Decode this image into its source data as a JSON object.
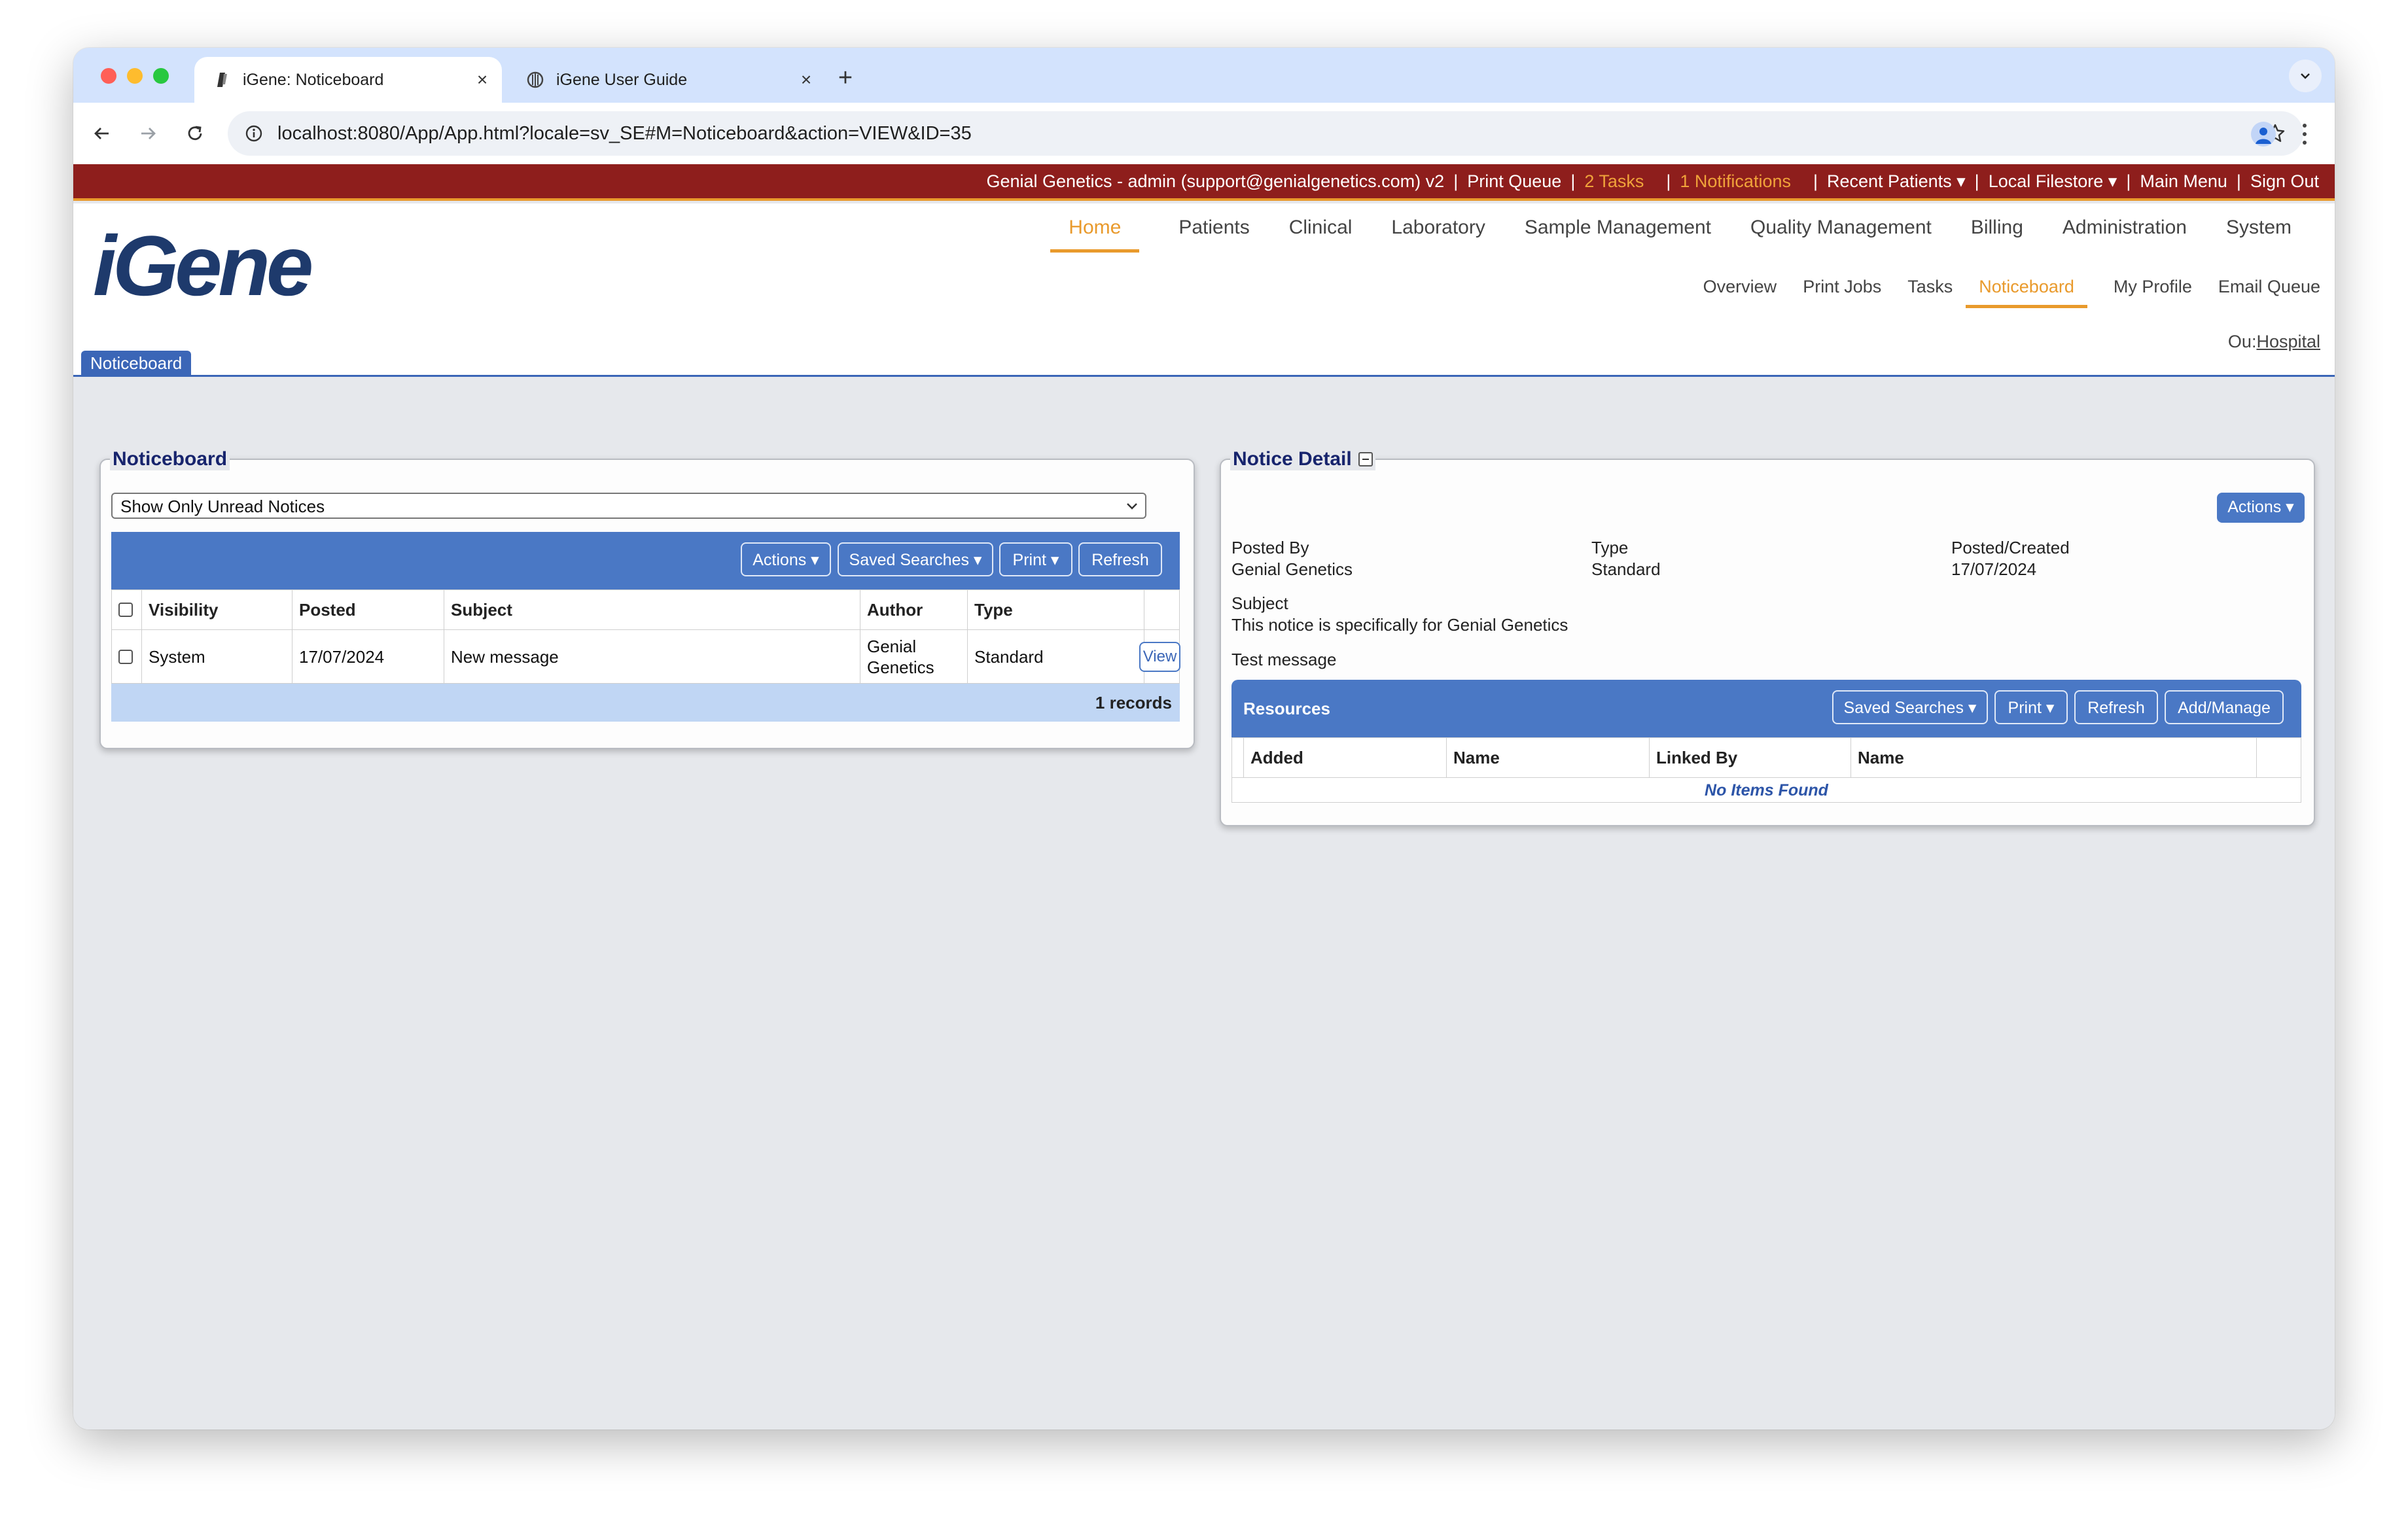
{
  "browser": {
    "tabs": [
      {
        "title": "iGene: Noticeboard",
        "active": true
      },
      {
        "title": "iGene User Guide",
        "active": false
      }
    ],
    "url": "localhost:8080/App/App.html?locale=sv_SE#M=Noticeboard&action=VIEW&ID=35"
  },
  "topbar": {
    "user": "Genial Genetics - admin (support@genialgenetics.com)",
    "version": "v2",
    "print_queue": "Print Queue",
    "tasks": "2 Tasks",
    "notifications": "1 Notifications",
    "recent_patients": "Recent Patients ▾",
    "local_filestore": "Local Filestore ▾",
    "main_menu": "Main Menu",
    "sign_out": "Sign Out",
    "accent_color": "#e99a2c",
    "bar_color": "#8e1e1c"
  },
  "logo": "iGene",
  "main_nav": [
    "Home",
    "Patients",
    "Clinical",
    "Laboratory",
    "Sample Management",
    "Quality Management",
    "Billing",
    "Administration",
    "System"
  ],
  "sub_nav": [
    "Overview",
    "Print Jobs",
    "Tasks",
    "Noticeboard",
    "My Profile",
    "Email Queue"
  ],
  "ou": {
    "label": "Ou:",
    "value": "Hospital"
  },
  "page_tab": "Noticeboard",
  "noticeboard": {
    "title": "Noticeboard",
    "filter": "Show Only Unread Notices",
    "buttons": {
      "actions": "Actions ▾",
      "saved_searches": "Saved Searches ▾",
      "print": "Print ▾",
      "refresh": "Refresh"
    },
    "columns": [
      "Visibility",
      "Posted",
      "Subject",
      "Author",
      "Type"
    ],
    "rows": [
      {
        "visibility": "System",
        "posted": "17/07/2024",
        "subject": "New message",
        "author": "Genial Genetics",
        "type": "Standard",
        "action": "View"
      }
    ],
    "records": "1 records"
  },
  "notice_detail": {
    "title": "Notice Detail",
    "actions": "Actions ▾",
    "posted_by_label": "Posted By",
    "posted_by": "Genial Genetics",
    "type_label": "Type",
    "type": "Standard",
    "posted_created_label": "Posted/Created",
    "posted_created": "17/07/2024",
    "subject_label": "Subject",
    "subject": "This notice is specifically for Genial Genetics",
    "message": "Test message",
    "resources": {
      "title": "Resources",
      "buttons": {
        "saved_searches": "Saved Searches ▾",
        "print": "Print ▾",
        "refresh": "Refresh",
        "add_manage": "Add/Manage"
      },
      "columns": [
        "Added",
        "Name",
        "Linked By",
        "Name"
      ],
      "empty": "No Items Found"
    }
  }
}
